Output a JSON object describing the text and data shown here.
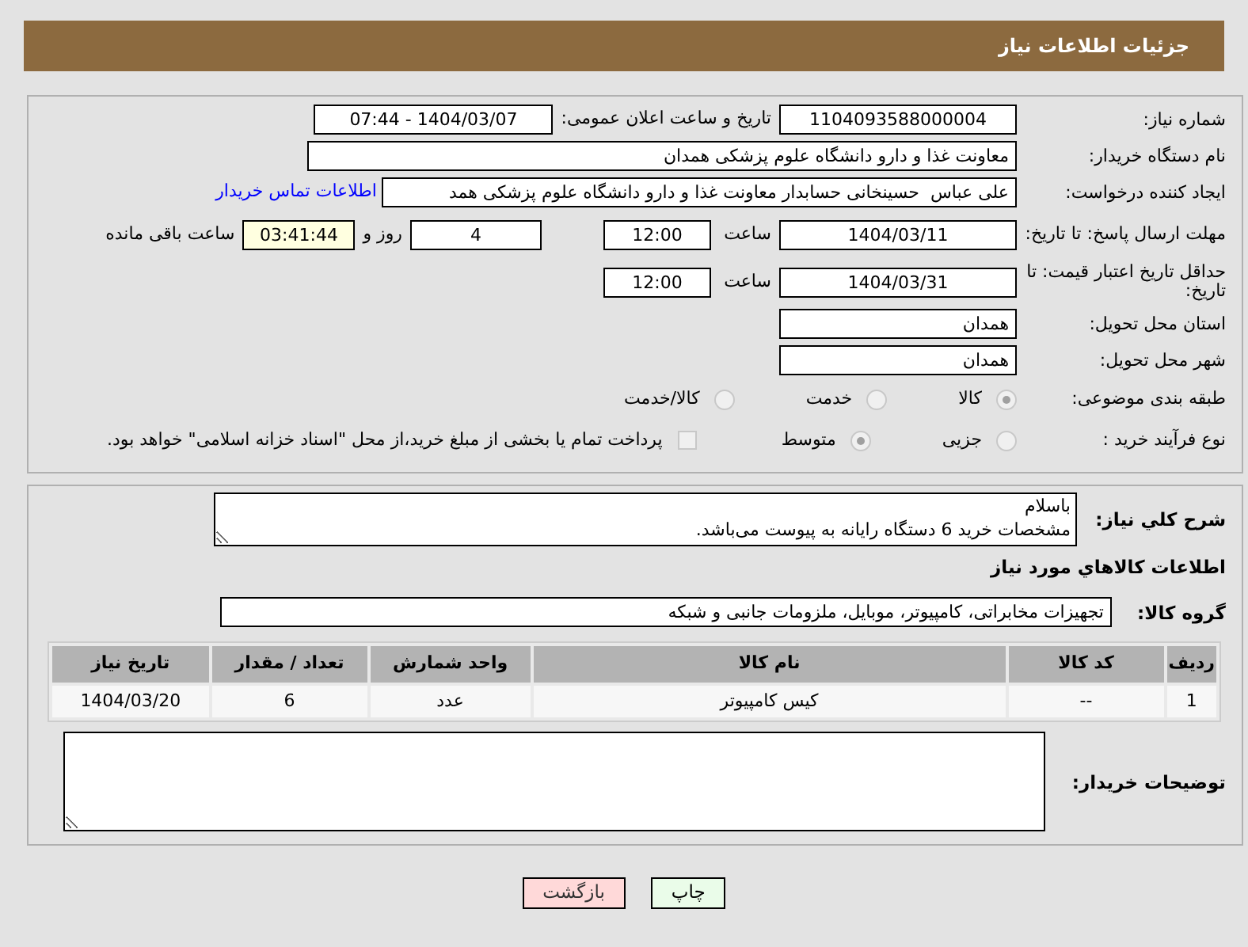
{
  "header": {
    "title": "جزئیات اطلاعات نیاز"
  },
  "need_number": {
    "label": "شماره نیاز:",
    "value": "1104093588000004"
  },
  "announce": {
    "label": "تاریخ و ساعت اعلان عمومی:",
    "value": "1404/03/07 - 07:44"
  },
  "buyer_org": {
    "label": "نام دستگاه خریدار:",
    "value": "معاونت غذا و دارو دانشگاه علوم پزشکی همدان"
  },
  "requester": {
    "label": "ایجاد کننده درخواست:",
    "value": "علی عباس  حسینخانی حسابدار معاونت غذا و دارو دانشگاه علوم پزشکی همد",
    "link": "اطلاعات تماس خریدار"
  },
  "reply_deadline": {
    "label": "مهلت ارسال پاسخ: تا تاریخ:",
    "date": "1404/03/11",
    "time_label": "ساعت",
    "time": "12:00",
    "days": "4",
    "days_label": "روز و",
    "remaining": "03:41:44",
    "remaining_label": "ساعت باقی مانده"
  },
  "price_validity": {
    "label": "حداقل تاریخ اعتبار قیمت: تا تاریخ:",
    "date": "1404/03/31",
    "time_label": "ساعت",
    "time": "12:00"
  },
  "province": {
    "label": "استان محل تحویل:",
    "value": "همدان"
  },
  "city": {
    "label": "شهر محل تحویل:",
    "value": "همدان"
  },
  "category": {
    "label": "طبقه بندی موضوعی:",
    "options": [
      {
        "label": "کالا",
        "selected": true
      },
      {
        "label": "خدمت",
        "selected": false
      },
      {
        "label": "کالا/خدمت",
        "selected": false
      }
    ]
  },
  "process": {
    "label": "نوع فرآیند خرید :",
    "options": [
      {
        "label": "جزیی",
        "selected": false
      },
      {
        "label": "متوسط",
        "selected": true
      }
    ],
    "payment": {
      "checked": false,
      "text": "پرداخت تمام یا بخشی از مبلغ خرید،از محل \"اسناد خزانه اسلامی\" خواهد بود."
    }
  },
  "description": {
    "label": "شرح کلي نیاز:",
    "value": "باسلام\nمشخصات خرید 6 دستگاه رایانه به پیوست می‌باشد."
  },
  "goods_heading": "اطلاعات کالاهاي مورد نیاز",
  "goods_group": {
    "label": "گروه کالا:",
    "value": "تجهیزات مخابراتی، کامپیوتر، موبایل، ملزومات جانبی و شبکه"
  },
  "table": {
    "columns": [
      "ردیف",
      "کد کالا",
      "نام کالا",
      "واحد شمارش",
      "تعداد / مقدار",
      "تاریخ نیاز"
    ],
    "rows": [
      [
        "1",
        "--",
        "کیس کامپیوتر",
        "عدد",
        "6",
        "1404/03/20"
      ]
    ]
  },
  "buyer_notes": {
    "label": "توضیحات خریدار:"
  },
  "buttons": [
    {
      "label": "چاپ",
      "kind": "print"
    },
    {
      "label": "بازگشت",
      "kind": "back"
    }
  ]
}
